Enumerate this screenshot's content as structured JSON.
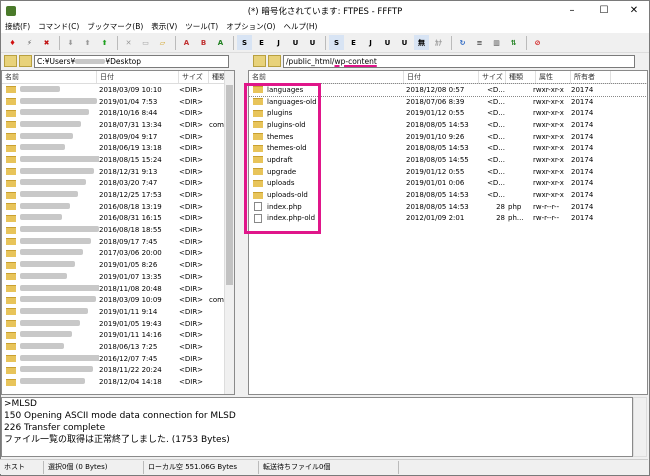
{
  "window": {
    "title": "(*) 暗号化されています: FTPES - FFFTP"
  },
  "menu": [
    "接続(F)",
    "コマンド(C)",
    "ブックマーク(B)",
    "表示(V)",
    "ツール(T)",
    "オプション(O)",
    "ヘルプ(H)"
  ],
  "toolbar": [
    "S",
    "E",
    "J",
    "U",
    "U",
    "S",
    "E",
    "J",
    "U",
    "U",
    "無",
    "ｶﾅ"
  ],
  "local": {
    "path": "C:¥Users¥",
    "path_suffix": "¥Desktop",
    "columns": [
      "名前",
      "日付",
      "サイズ",
      "種類"
    ],
    "rows": [
      {
        "date": "2018/03/09 10:10",
        "size": "<DIR>",
        "type": ""
      },
      {
        "date": "2019/01/04 7:53",
        "size": "<DIR>",
        "type": ""
      },
      {
        "date": "2018/10/16 8:44",
        "size": "<DIR>",
        "type": ""
      },
      {
        "date": "2018/07/31 13:34",
        "size": "<DIR>",
        "type": "com"
      },
      {
        "date": "2018/09/04 9:17",
        "size": "<DIR>",
        "type": ""
      },
      {
        "date": "2018/06/19 13:18",
        "size": "<DIR>",
        "type": ""
      },
      {
        "date": "2018/08/15 15:24",
        "size": "<DIR>",
        "type": ""
      },
      {
        "date": "2018/12/31 9:13",
        "size": "<DIR>",
        "type": ""
      },
      {
        "date": "2018/03/20 7:47",
        "size": "<DIR>",
        "type": ""
      },
      {
        "date": "2018/12/25 17:53",
        "size": "<DIR>",
        "type": ""
      },
      {
        "date": "2016/08/18 13:19",
        "size": "<DIR>",
        "type": ""
      },
      {
        "date": "2016/08/31 16:15",
        "size": "<DIR>",
        "type": ""
      },
      {
        "date": "2016/08/18 18:55",
        "size": "<DIR>",
        "type": ""
      },
      {
        "date": "2018/09/17 7:45",
        "size": "<DIR>",
        "type": ""
      },
      {
        "date": "2017/03/06 20:00",
        "size": "<DIR>",
        "type": ""
      },
      {
        "date": "2019/01/05 8:26",
        "size": "<DIR>",
        "type": ""
      },
      {
        "date": "2019/01/07 13:35",
        "size": "<DIR>",
        "type": ""
      },
      {
        "date": "2018/11/08 20:48",
        "size": "<DIR>",
        "type": ""
      },
      {
        "date": "2018/03/09 10:09",
        "size": "<DIR>",
        "type": "com"
      },
      {
        "date": "2019/01/11 9:14",
        "size": "<DIR>",
        "type": ""
      },
      {
        "date": "2019/01/05 19:43",
        "size": "<DIR>",
        "type": ""
      },
      {
        "date": "2019/01/11 14:16",
        "size": "<DIR>",
        "type": ""
      },
      {
        "date": "2018/06/13 7:25",
        "size": "<DIR>",
        "type": ""
      },
      {
        "date": "2016/12/07 7:45",
        "size": "<DIR>",
        "type": ""
      },
      {
        "date": "2018/11/22 20:24",
        "size": "<DIR>",
        "type": ""
      },
      {
        "date": "2018/12/04 14:18",
        "size": "<DIR>",
        "type": ""
      }
    ]
  },
  "remote": {
    "path_prefix": "/public_html/",
    "path_hl": "wp-content",
    "columns": [
      "名前",
      "日付",
      "サイズ",
      "種類",
      "属性",
      "所有者"
    ],
    "rows": [
      {
        "name": "languages",
        "date": "2018/12/08 0:57",
        "size": "<D...",
        "type": "",
        "attr": "rwxr-xr-x",
        "owner": "20174",
        "kind": "folder"
      },
      {
        "name": "languages-old",
        "date": "2018/07/06 8:39",
        "size": "<D...",
        "type": "",
        "attr": "rwxr-xr-x",
        "owner": "20174",
        "kind": "folder"
      },
      {
        "name": "plugins",
        "date": "2019/01/12 0:55",
        "size": "<D...",
        "type": "",
        "attr": "rwxr-xr-x",
        "owner": "20174",
        "kind": "folder"
      },
      {
        "name": "plugins-old",
        "date": "2018/08/05 14:53",
        "size": "<D...",
        "type": "",
        "attr": "rwxr-xr-x",
        "owner": "20174",
        "kind": "folder"
      },
      {
        "name": "themes",
        "date": "2019/01/10 9:26",
        "size": "<D...",
        "type": "",
        "attr": "rwxr-xr-x",
        "owner": "20174",
        "kind": "folder"
      },
      {
        "name": "themes-old",
        "date": "2018/08/05 14:53",
        "size": "<D...",
        "type": "",
        "attr": "rwxr-xr-x",
        "owner": "20174",
        "kind": "folder"
      },
      {
        "name": "updraft",
        "date": "2018/08/05 14:55",
        "size": "<D...",
        "type": "",
        "attr": "rwxr-xr-x",
        "owner": "20174",
        "kind": "folder"
      },
      {
        "name": "upgrade",
        "date": "2019/01/12 0:55",
        "size": "<D...",
        "type": "",
        "attr": "rwxr-xr-x",
        "owner": "20174",
        "kind": "folder"
      },
      {
        "name": "uploads",
        "date": "2019/01/01 0:06",
        "size": "<D...",
        "type": "",
        "attr": "rwxr-xr-x",
        "owner": "20174",
        "kind": "folder"
      },
      {
        "name": "uploads-old",
        "date": "2018/08/05 14:53",
        "size": "<D...",
        "type": "",
        "attr": "rwxr-xr-x",
        "owner": "20174",
        "kind": "folder"
      },
      {
        "name": "index.php",
        "date": "2018/08/05 14:53",
        "size": "28",
        "type": "php",
        "attr": "rw-r--r--",
        "owner": "20174",
        "kind": "file"
      },
      {
        "name": "index.php-old",
        "date": "2012/01/09 2:01",
        "size": "28",
        "type": "ph...",
        "attr": "rw-r--r--",
        "owner": "20174",
        "kind": "file"
      }
    ]
  },
  "log": [
    ">MLSD",
    "150 Opening ASCII mode data connection for MLSD",
    "226 Transfer complete",
    "ファイル一覧の取得は正常終了しました. (1753 Bytes)"
  ],
  "status": {
    "host": "ホスト",
    "selected": "選択0個 (0 Bytes)",
    "local_free": "ローカル空 551.06G Bytes",
    "queue": "転送待ちファイル0個"
  }
}
